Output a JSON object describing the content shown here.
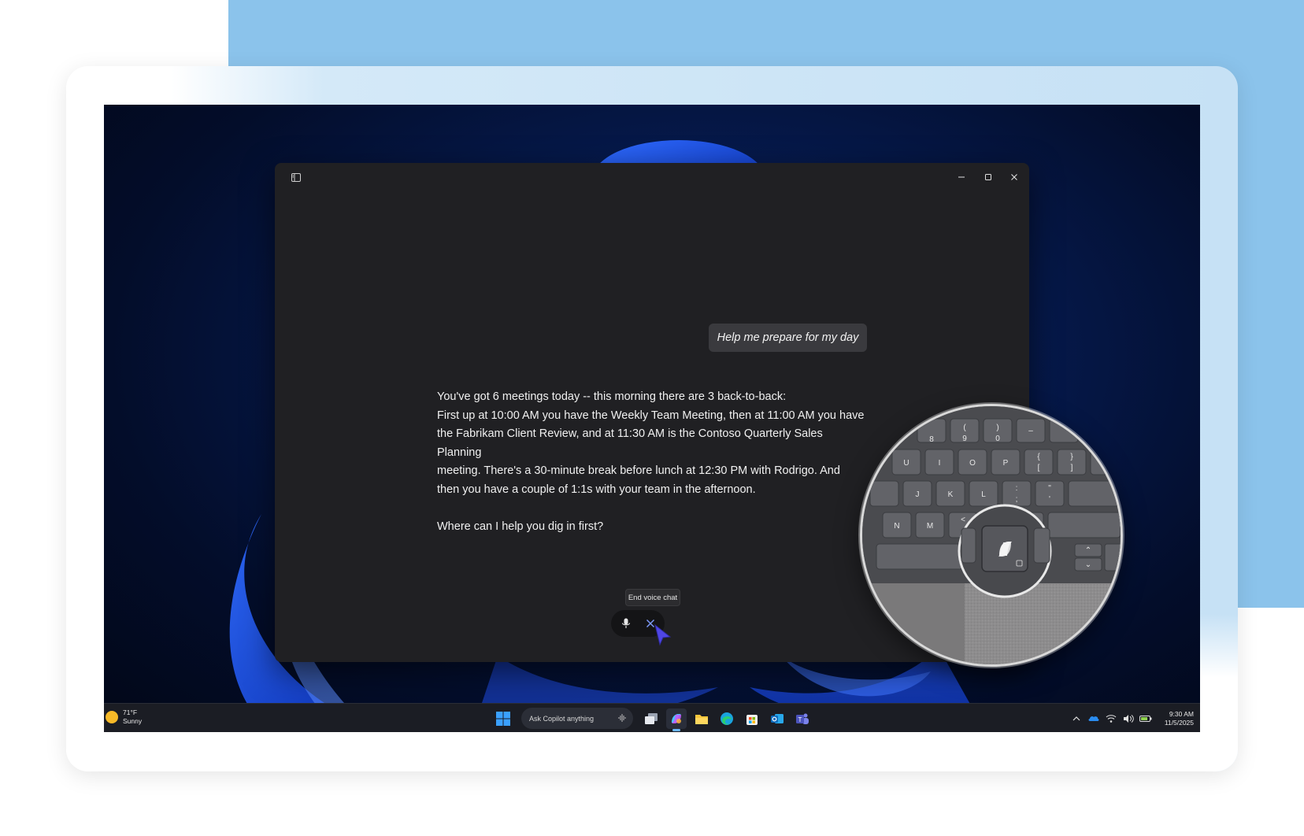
{
  "colors": {
    "backdrop_blue": "#8bc3eb",
    "window_bg": "#202023",
    "bubble_bg": "#3a3a3e",
    "accent_cursor": "#4f46e5",
    "taskbar_bg": "#1b1d24"
  },
  "copilot_window": {
    "user_message": "Help me prepare for my day",
    "reply_lines": [
      "You've got 6 meetings today -- this morning there are 3 back-to-back:",
      "First up at 10:00 AM you have the Weekly Team Meeting, then at 11:00 AM you have",
      "the Fabrikam Client Review, and at 11:30 AM is the Contoso Quarterly Sales Planning",
      "meeting. There's a 30-minute break before lunch at 12:30 PM with Rodrigo. And",
      "then you have a couple of 1:1s with your team in the afternoon."
    ],
    "reply_question": "Where can I help you dig in first?",
    "tooltip": "End voice chat",
    "icons": {
      "sidebar": "sidebar-toggle-icon",
      "minimize": "minimize-icon",
      "maximize": "maximize-icon",
      "close": "close-icon",
      "mic": "microphone-icon",
      "end": "close-x-icon"
    }
  },
  "taskbar": {
    "weather_temp": "71°F",
    "weather_desc": "Sunny",
    "search_placeholder": "Ask Copilot anything",
    "time": "9:30 AM",
    "date": "11/5/2025",
    "pinned_icons": [
      "windows-start-icon",
      "task-view-icon",
      "copilot-icon",
      "file-explorer-icon",
      "edge-icon",
      "microsoft-store-icon",
      "outlook-icon",
      "teams-icon"
    ],
    "tray_icons": [
      "show-hidden-icons-chevron",
      "onedrive-icon",
      "wifi-icon",
      "volume-icon",
      "battery-icon"
    ]
  },
  "magnifier": {
    "keys": [
      "(",
      "9",
      ")",
      "0",
      "U",
      "I",
      "O",
      "P",
      "{",
      "[",
      "}",
      "]",
      "J",
      "K",
      "L",
      ":",
      ";",
      "\"",
      "'",
      "N",
      "M",
      "<",
      ","
    ],
    "highlight_key_icon": "copilot-key-icon"
  }
}
